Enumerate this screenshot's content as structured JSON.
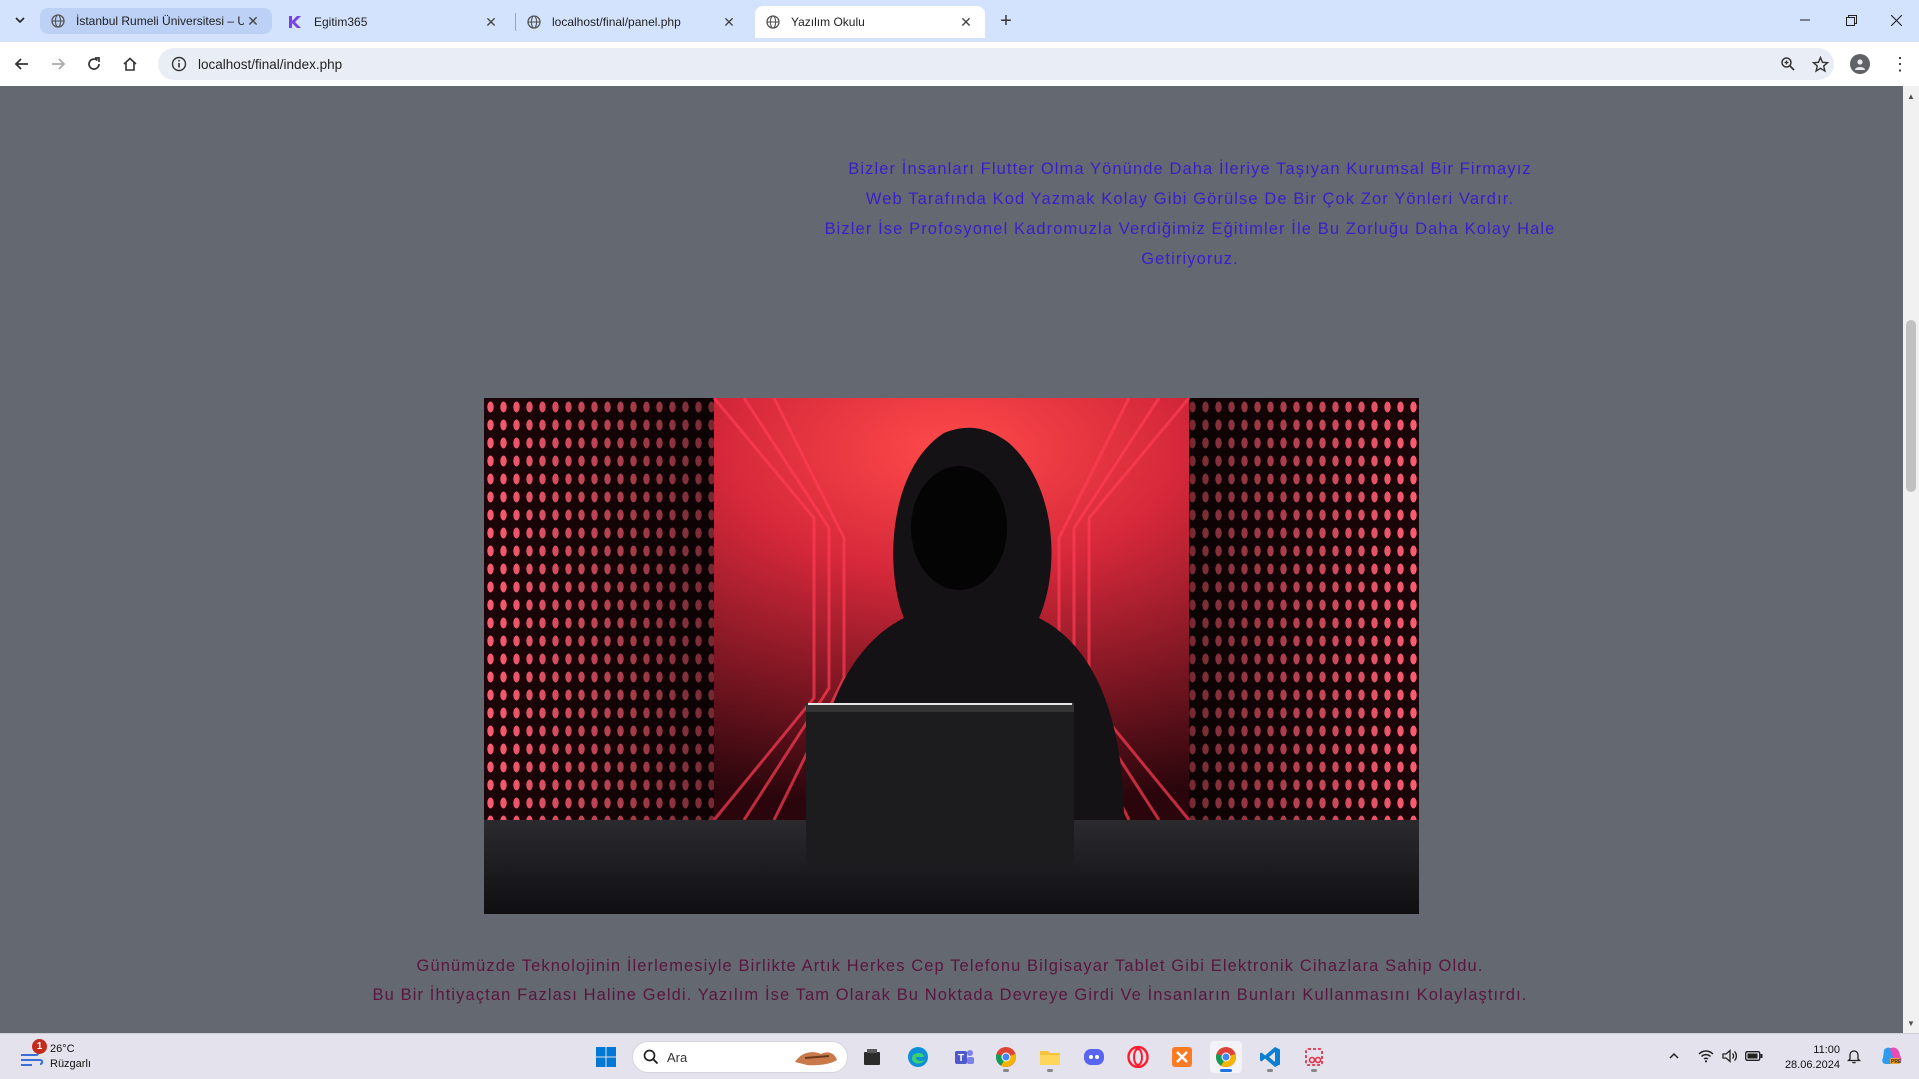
{
  "browser": {
    "tabs": [
      {
        "title": "İstanbul Rumeli Üniversitesi – U",
        "state": "hover"
      },
      {
        "title": "Egitim365",
        "state": "normal"
      },
      {
        "title": "localhost/final/panel.php",
        "state": "normal"
      },
      {
        "title": "Yazılım Okulu",
        "state": "active"
      }
    ],
    "url": "localhost/final/index.php"
  },
  "page": {
    "intro_lines": [
      "Bizler İnsanları Flutter Olma Yönünde Daha İleriye Taşıyan Kurumsal Bir Firmayız",
      "Web Tarafında Kod Yazmak Kolay Gibi Görülse De Bir Çok Zor Yönleri Vardır.",
      "Bizler İse Profosyonel Kadromuzla Verdiğimiz Eğitimler İle Bu Zorluğu Daha Kolay Hale Getiriyoruz."
    ],
    "outro_lines": [
      "Günümüzde Teknolojinin İlerlemesiyle Birlikte Artık Herkes Cep Telefonu Bilgisayar Tablet Gibi Elektronik Cihazlara Sahip Oldu.",
      "Bu Bir İhtiyaçtan Fazlası Haline Geldi. Yazılım İse Tam Olarak Bu Noktada Devreye Girdi Ve İnsanların Bunları Kullanmasını Kolaylaştırdı."
    ],
    "colors": {
      "background": "#646870",
      "intro_text": "#3a1fc9",
      "outro_text": "#5a1540"
    }
  },
  "taskbar": {
    "weather": {
      "temp": "26°C",
      "condition": "Rüzgarlı",
      "badge": "1"
    },
    "search_placeholder": "Ara",
    "apps": [
      "start-icon",
      "search",
      "file-manager-icon",
      "edge-icon",
      "teams-icon",
      "chrome-icon",
      "file-explorer-icon",
      "discord-icon",
      "opera-icon",
      "xampp-icon",
      "chrome-icon",
      "vscode-icon",
      "snipping-tool-icon"
    ],
    "time": "11:00",
    "date": "28.06.2024"
  }
}
